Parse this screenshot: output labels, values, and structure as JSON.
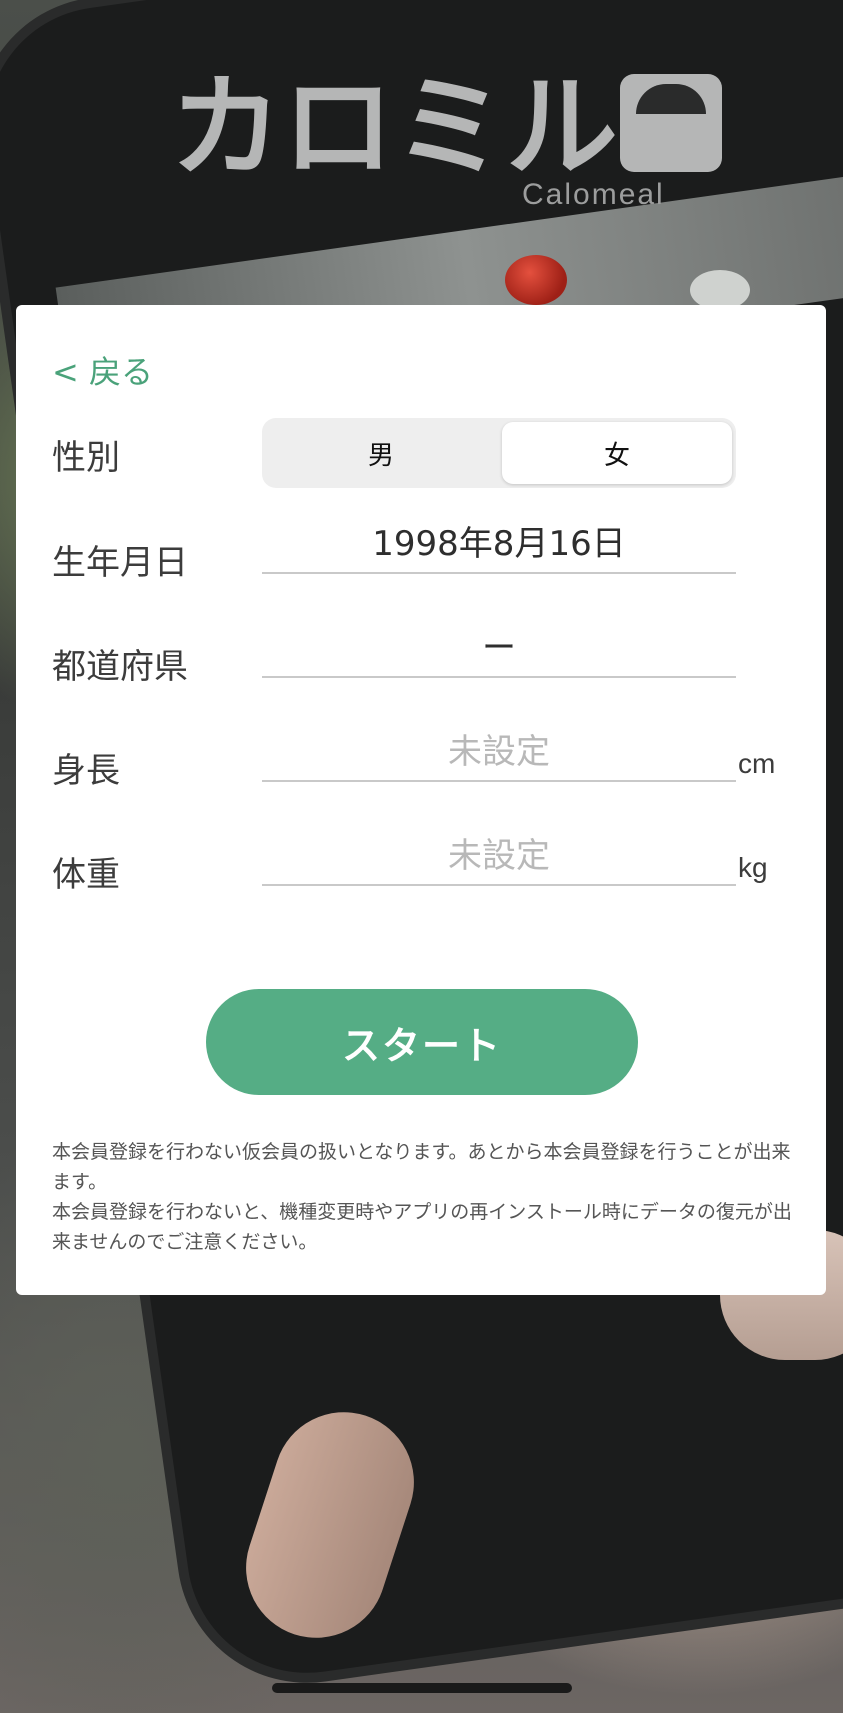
{
  "logo": {
    "title": "カロミル",
    "subtitle": "Calomeal"
  },
  "form": {
    "back_label": "< 戻る",
    "gender": {
      "label": "性別",
      "options": [
        "男",
        "女"
      ],
      "selected": "女"
    },
    "birthdate": {
      "label": "生年月日",
      "value": "1998年8月16日"
    },
    "prefecture": {
      "label": "都道府県",
      "value": "ー"
    },
    "height": {
      "label": "身長",
      "placeholder": "未設定",
      "unit": "cm"
    },
    "weight": {
      "label": "体重",
      "placeholder": "未設定",
      "unit": "kg"
    },
    "start_label": "スタート",
    "notice": [
      "本会員登録を行わない仮会員の扱いとなります。あとから本会員登録を行うことが出来ます。",
      "本会員登録を行わないと、機種変更時やアプリの再インストール時にデータの復元が出来ませんのでご注意ください。"
    ]
  },
  "colors": {
    "accent": "#55ad85",
    "back_link": "#4aa27a"
  }
}
